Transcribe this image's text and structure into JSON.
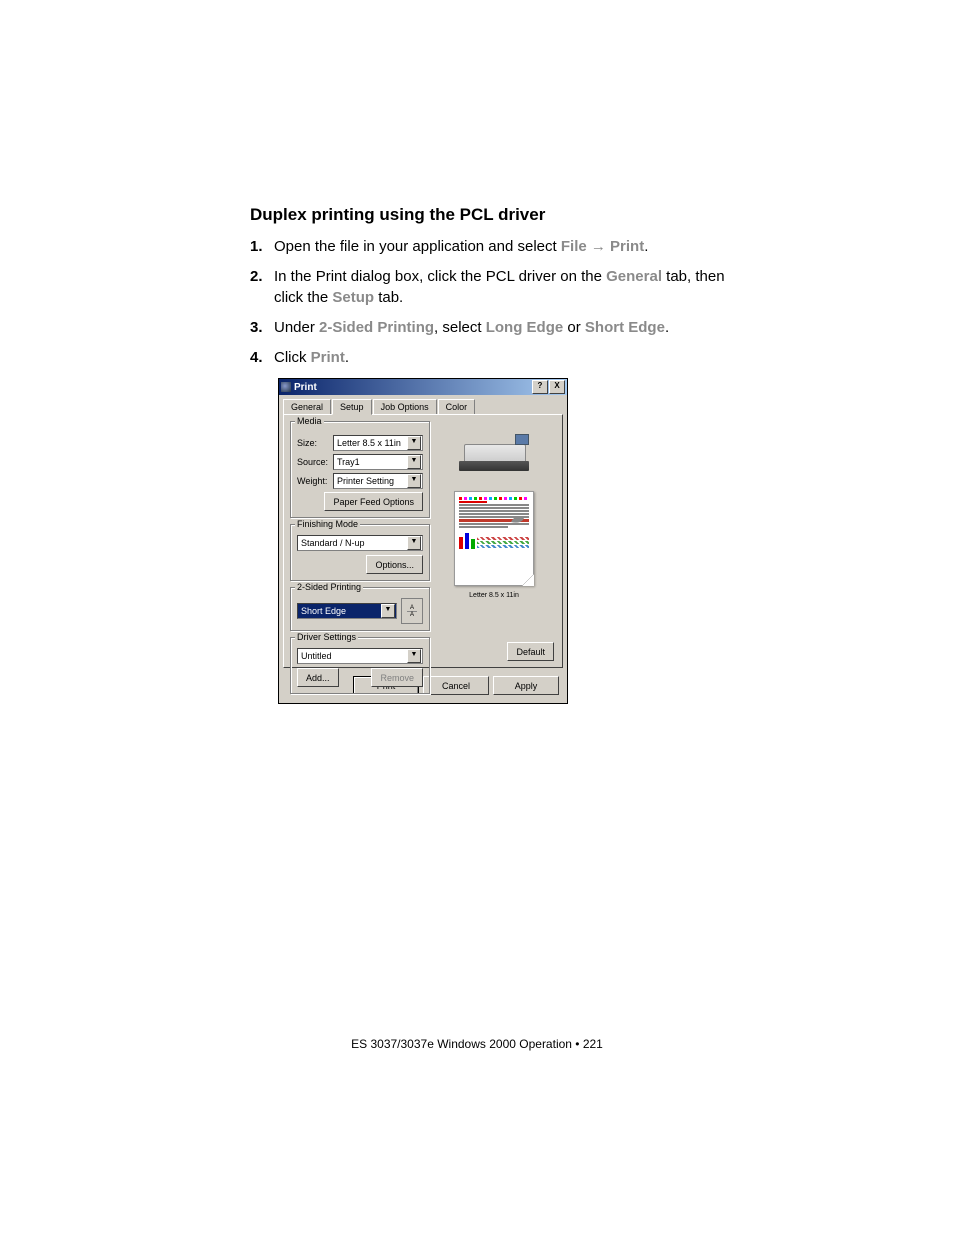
{
  "heading": "Duplex printing using the PCL driver",
  "steps": [
    {
      "num": "1.",
      "pre": "Open the file in your application and select ",
      "t1": "File",
      "arrow": " → ",
      "t2": "Print",
      "post": "."
    },
    {
      "num": "2.",
      "pre": "In the Print dialog box, click the  PCL driver on the ",
      "t1": "General",
      "mid": " tab, then click the ",
      "t2": "Setup",
      "post": " tab."
    },
    {
      "num": "3.",
      "pre": "Under ",
      "t1": "2-Sided Printing",
      "mid": ", select ",
      "t2": "Long Edge",
      "mid2": " or ",
      "t3": "Short Edge",
      "post": "."
    },
    {
      "num": "4.",
      "pre": "Click ",
      "t1": "Print",
      "post": "."
    }
  ],
  "dialog": {
    "title": "Print",
    "help_btn": "?",
    "close_btn": "X",
    "tabs": [
      "General",
      "Setup",
      "Job Options",
      "Color"
    ],
    "media": {
      "legend": "Media",
      "size_label": "Size:",
      "size_value": "Letter 8.5 x 11in",
      "source_label": "Source:",
      "source_value": "Tray1",
      "weight_label": "Weight:",
      "weight_value": "Printer Setting",
      "paper_feed_btn": "Paper Feed Options"
    },
    "finishing": {
      "legend": "Finishing Mode",
      "value": "Standard / N-up",
      "options_btn": "Options..."
    },
    "duplex": {
      "legend": "2-Sided Printing",
      "value": "Short Edge"
    },
    "driver": {
      "legend": "Driver Settings",
      "value": "Untitled",
      "add_btn": "Add...",
      "remove_btn": "Remove"
    },
    "preview_caption": "Letter 8.5 x 11in",
    "default_btn": "Default",
    "print_btn": "Print",
    "cancel_btn": "Cancel",
    "apply_btn": "Apply"
  },
  "footer": "ES 3037/3037e Windows 2000 Operation • 221"
}
